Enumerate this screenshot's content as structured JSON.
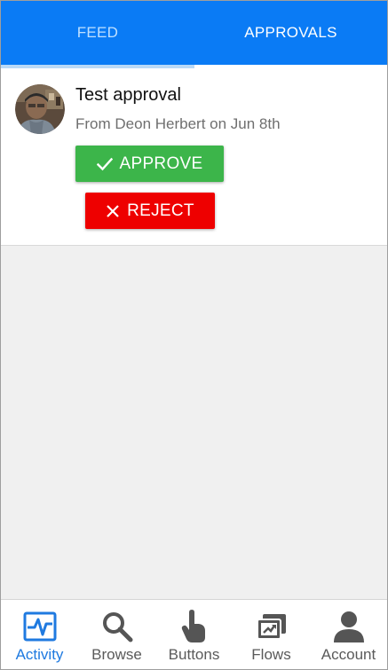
{
  "tabs": [
    {
      "label": "FEED",
      "active": false
    },
    {
      "label": "APPROVALS",
      "active": true
    }
  ],
  "approval": {
    "title": "Test approval",
    "subtitle": "From Deon Herbert on Jun 8th",
    "approve_label": "APPROVE",
    "reject_label": "REJECT"
  },
  "bottom_nav": [
    {
      "label": "Activity",
      "icon": "activity-icon",
      "active": true
    },
    {
      "label": "Browse",
      "icon": "search-icon",
      "active": false
    },
    {
      "label": "Buttons",
      "icon": "touch-icon",
      "active": false
    },
    {
      "label": "Flows",
      "icon": "flows-icon",
      "active": false
    },
    {
      "label": "Account",
      "icon": "person-icon",
      "active": false
    }
  ],
  "colors": {
    "header_blue": "#0a7bf5",
    "approve_green": "#3cb54a",
    "reject_red": "#ee0000",
    "active_nav": "#1f7ae0"
  }
}
